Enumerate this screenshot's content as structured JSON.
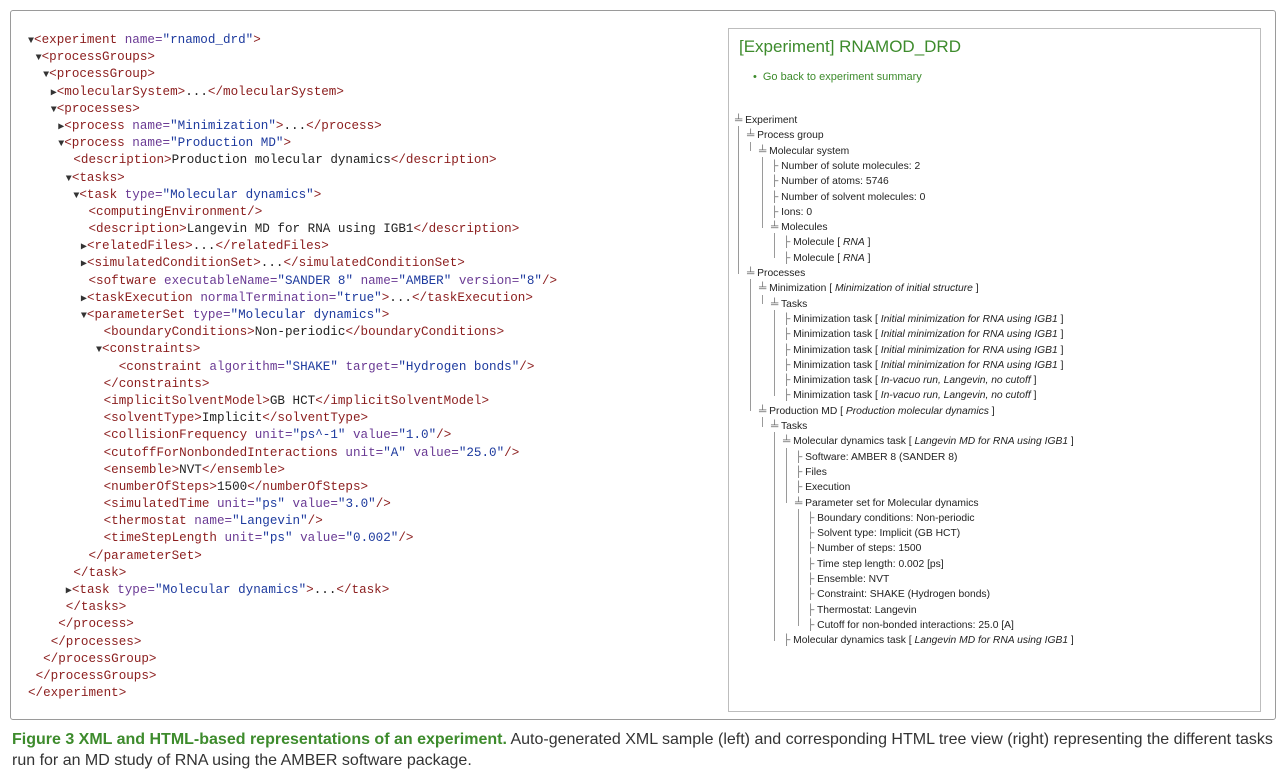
{
  "xml_lines": [
    {
      "d": 0,
      "h": [
        [
          "tri",
          "▼"
        ],
        [
          "tg",
          "<experiment "
        ],
        [
          "at",
          "name="
        ],
        [
          "av",
          "\"rnamod_drd\""
        ],
        [
          "tg",
          ">"
        ]
      ]
    },
    {
      "d": 1,
      "h": [
        [
          "tri",
          "▼"
        ],
        [
          "tg",
          "<processGroups>"
        ]
      ]
    },
    {
      "d": 2,
      "h": [
        [
          "tri",
          "▼"
        ],
        [
          "tg",
          "<processGroup>"
        ]
      ]
    },
    {
      "d": 3,
      "h": [
        [
          "tri",
          "▶"
        ],
        [
          "tg",
          "<molecularSystem>"
        ],
        [
          "tx",
          "..."
        ],
        [
          "tg",
          "</molecularSystem>"
        ]
      ]
    },
    {
      "d": 3,
      "h": [
        [
          "tri",
          "▼"
        ],
        [
          "tg",
          "<processes>"
        ]
      ]
    },
    {
      "d": 4,
      "h": [
        [
          "tri",
          "▶"
        ],
        [
          "tg",
          "<process "
        ],
        [
          "at",
          "name="
        ],
        [
          "av",
          "\"Minimization\""
        ],
        [
          "tg",
          ">"
        ],
        [
          "tx",
          "..."
        ],
        [
          "tg",
          "</process>"
        ]
      ]
    },
    {
      "d": 4,
      "h": [
        [
          "tri",
          "▼"
        ],
        [
          "tg",
          "<process "
        ],
        [
          "at",
          "name="
        ],
        [
          "av",
          "\"Production MD\""
        ],
        [
          "tg",
          ">"
        ]
      ]
    },
    {
      "d": 6,
      "h": [
        [
          "tg",
          "<description>"
        ],
        [
          "tx",
          "Production molecular dynamics"
        ],
        [
          "tg",
          "</description>"
        ]
      ]
    },
    {
      "d": 5,
      "h": [
        [
          "tri",
          "▼"
        ],
        [
          "tg",
          "<tasks>"
        ]
      ]
    },
    {
      "d": 6,
      "h": [
        [
          "tri",
          "▼"
        ],
        [
          "tg",
          "<task "
        ],
        [
          "at",
          "type="
        ],
        [
          "av",
          "\"Molecular dynamics\""
        ],
        [
          "tg",
          ">"
        ]
      ]
    },
    {
      "d": 8,
      "h": [
        [
          "tg",
          "<computingEnvironment/>"
        ]
      ]
    },
    {
      "d": 8,
      "h": [
        [
          "tg",
          "<description>"
        ],
        [
          "tx",
          "Langevin MD for RNA using IGB1"
        ],
        [
          "tg",
          "</description>"
        ]
      ]
    },
    {
      "d": 7,
      "h": [
        [
          "tri",
          "▶"
        ],
        [
          "tg",
          "<relatedFiles>"
        ],
        [
          "tx",
          "..."
        ],
        [
          "tg",
          "</relatedFiles>"
        ]
      ]
    },
    {
      "d": 7,
      "h": [
        [
          "tri",
          "▶"
        ],
        [
          "tg",
          "<simulatedConditionSet>"
        ],
        [
          "tx",
          "..."
        ],
        [
          "tg",
          "</simulatedConditionSet>"
        ]
      ]
    },
    {
      "d": 8,
      "h": [
        [
          "tg",
          "<software "
        ],
        [
          "at",
          "executableName="
        ],
        [
          "av",
          "\"SANDER 8\" "
        ],
        [
          "at",
          "name="
        ],
        [
          "av",
          "\"AMBER\" "
        ],
        [
          "at",
          "version="
        ],
        [
          "av",
          "\"8\""
        ],
        [
          "tg",
          "/>"
        ]
      ]
    },
    {
      "d": 7,
      "h": [
        [
          "tri",
          "▶"
        ],
        [
          "tg",
          "<taskExecution "
        ],
        [
          "at",
          "normalTermination="
        ],
        [
          "av",
          "\"true\""
        ],
        [
          "tg",
          ">"
        ],
        [
          "tx",
          "..."
        ],
        [
          "tg",
          "</taskExecution>"
        ]
      ]
    },
    {
      "d": 7,
      "h": [
        [
          "tri",
          "▼"
        ],
        [
          "tg",
          "<parameterSet "
        ],
        [
          "at",
          "type="
        ],
        [
          "av",
          "\"Molecular dynamics\""
        ],
        [
          "tg",
          ">"
        ]
      ]
    },
    {
      "d": 10,
      "h": [
        [
          "tg",
          "<boundaryConditions>"
        ],
        [
          "tx",
          "Non-periodic"
        ],
        [
          "tg",
          "</boundaryConditions>"
        ]
      ]
    },
    {
      "d": 9,
      "h": [
        [
          "tri",
          "▼"
        ],
        [
          "tg",
          "<constraints>"
        ]
      ]
    },
    {
      "d": 12,
      "h": [
        [
          "tg",
          "<constraint "
        ],
        [
          "at",
          "algorithm="
        ],
        [
          "av",
          "\"SHAKE\" "
        ],
        [
          "at",
          "target="
        ],
        [
          "av",
          "\"Hydrogen bonds\""
        ],
        [
          "tg",
          "/>"
        ]
      ]
    },
    {
      "d": 10,
      "h": [
        [
          "tg",
          "</constraints>"
        ]
      ]
    },
    {
      "d": 10,
      "h": [
        [
          "tg",
          "<implicitSolventModel>"
        ],
        [
          "tx",
          "GB HCT"
        ],
        [
          "tg",
          "</implicitSolventModel>"
        ]
      ]
    },
    {
      "d": 10,
      "h": [
        [
          "tg",
          "<solventType>"
        ],
        [
          "tx",
          "Implicit"
        ],
        [
          "tg",
          "</solventType>"
        ]
      ]
    },
    {
      "d": 10,
      "h": [
        [
          "tg",
          "<collisionFrequency "
        ],
        [
          "at",
          "unit="
        ],
        [
          "av",
          "\"ps^-1\" "
        ],
        [
          "at",
          "value="
        ],
        [
          "av",
          "\"1.0\""
        ],
        [
          "tg",
          "/>"
        ]
      ]
    },
    {
      "d": 10,
      "h": [
        [
          "tg",
          "<cutoffForNonbondedInteractions "
        ],
        [
          "at",
          "unit="
        ],
        [
          "av",
          "\"A\" "
        ],
        [
          "at",
          "value="
        ],
        [
          "av",
          "\"25.0\""
        ],
        [
          "tg",
          "/>"
        ]
      ]
    },
    {
      "d": 10,
      "h": [
        [
          "tg",
          "<ensemble>"
        ],
        [
          "tx",
          "NVT"
        ],
        [
          "tg",
          "</ensemble>"
        ]
      ]
    },
    {
      "d": 10,
      "h": [
        [
          "tg",
          "<numberOfSteps>"
        ],
        [
          "tx",
          "1500"
        ],
        [
          "tg",
          "</numberOfSteps>"
        ]
      ]
    },
    {
      "d": 10,
      "h": [
        [
          "tg",
          "<simulatedTime "
        ],
        [
          "at",
          "unit="
        ],
        [
          "av",
          "\"ps\" "
        ],
        [
          "at",
          "value="
        ],
        [
          "av",
          "\"3.0\""
        ],
        [
          "tg",
          "/>"
        ]
      ]
    },
    {
      "d": 10,
      "h": [
        [
          "tg",
          "<thermostat "
        ],
        [
          "at",
          "name="
        ],
        [
          "av",
          "\"Langevin\""
        ],
        [
          "tg",
          "/>"
        ]
      ]
    },
    {
      "d": 10,
      "h": [
        [
          "tg",
          "<timeStepLength "
        ],
        [
          "at",
          "unit="
        ],
        [
          "av",
          "\"ps\" "
        ],
        [
          "at",
          "value="
        ],
        [
          "av",
          "\"0.002\""
        ],
        [
          "tg",
          "/>"
        ]
      ]
    },
    {
      "d": 8,
      "h": [
        [
          "tg",
          "</parameterSet>"
        ]
      ]
    },
    {
      "d": 6,
      "h": [
        [
          "tg",
          "</task>"
        ]
      ]
    },
    {
      "d": 5,
      "h": [
        [
          "tri",
          "▶"
        ],
        [
          "tg",
          "<task "
        ],
        [
          "at",
          "type="
        ],
        [
          "av",
          "\"Molecular dynamics\""
        ],
        [
          "tg",
          ">"
        ],
        [
          "tx",
          "..."
        ],
        [
          "tg",
          "</task>"
        ]
      ]
    },
    {
      "d": 5,
      "h": [
        [
          "tg",
          "</tasks>"
        ]
      ]
    },
    {
      "d": 4,
      "h": [
        [
          "tg",
          "</process>"
        ]
      ]
    },
    {
      "d": 3,
      "h": [
        [
          "tg",
          "</processes>"
        ]
      ]
    },
    {
      "d": 2,
      "h": [
        [
          "tg",
          "</processGroup>"
        ]
      ]
    },
    {
      "d": 1,
      "h": [
        [
          "tg",
          "</processGroups>"
        ]
      ]
    },
    {
      "d": 0,
      "h": [
        [
          "tg",
          "</experiment>"
        ]
      ]
    }
  ],
  "tree": {
    "title": "[Experiment] RNAMOD_DRD",
    "back_link": "Go back to experiment summary",
    "nodes": [
      {
        "d": 0,
        "e": true,
        "t": "Experiment"
      },
      {
        "d": 1,
        "e": true,
        "t": "Process group"
      },
      {
        "d": 2,
        "e": true,
        "t": "Molecular system"
      },
      {
        "d": 3,
        "t": "Number of solute molecules: 2"
      },
      {
        "d": 3,
        "t": "Number of atoms: 5746"
      },
      {
        "d": 3,
        "t": "Number of solvent molecules: 0"
      },
      {
        "d": 3,
        "t": "Ions: 0"
      },
      {
        "d": 3,
        "e": true,
        "t": "Molecules"
      },
      {
        "d": 4,
        "t": "Molecule [ ",
        "i": "RNA",
        "s": " ]"
      },
      {
        "d": 4,
        "t": "Molecule [ ",
        "i": "RNA",
        "s": " ]"
      },
      {
        "d": 1,
        "e": true,
        "t": "Processes"
      },
      {
        "d": 2,
        "e": true,
        "t": "Minimization  [ ",
        "i": "Minimization of initial structure",
        "s": " ]"
      },
      {
        "d": 3,
        "e": true,
        "t": "Tasks"
      },
      {
        "d": 4,
        "t": "Minimization task [ ",
        "i": "Initial minimization for RNA using IGB1",
        "s": " ]"
      },
      {
        "d": 4,
        "t": "Minimization task [ ",
        "i": "Initial minimization for RNA using IGB1",
        "s": " ]"
      },
      {
        "d": 4,
        "t": "Minimization task [ ",
        "i": "Initial minimization for RNA using IGB1",
        "s": " ]"
      },
      {
        "d": 4,
        "t": "Minimization task [ ",
        "i": "Initial minimization for RNA using IGB1",
        "s": " ]"
      },
      {
        "d": 4,
        "t": "Minimization task [ ",
        "i": "In-vacuo run, Langevin, no cutoff",
        "s": " ]"
      },
      {
        "d": 4,
        "t": "Minimization task [ ",
        "i": "In-vacuo run, Langevin, no cutoff",
        "s": " ]"
      },
      {
        "d": 2,
        "e": true,
        "t": "Production MD  [ ",
        "i": "Production molecular dynamics",
        "s": " ]"
      },
      {
        "d": 3,
        "e": true,
        "t": "Tasks"
      },
      {
        "d": 4,
        "e": true,
        "t": "Molecular dynamics task [ ",
        "i": "Langevin MD for RNA using IGB1",
        "s": " ]"
      },
      {
        "d": 5,
        "t": "Software: AMBER  8  (SANDER 8)"
      },
      {
        "d": 5,
        "t": "Files"
      },
      {
        "d": 5,
        "t": "Execution"
      },
      {
        "d": 5,
        "e": true,
        "t": "Parameter set for Molecular dynamics"
      },
      {
        "d": 6,
        "t": "Boundary conditions: Non-periodic"
      },
      {
        "d": 6,
        "t": "Solvent type: Implicit (GB HCT)"
      },
      {
        "d": 6,
        "t": "Number of steps: 1500"
      },
      {
        "d": 6,
        "t": "Time step length: 0.002 [ps]"
      },
      {
        "d": 6,
        "t": "Ensemble: NVT"
      },
      {
        "d": 6,
        "t": "Constraint: SHAKE (Hydrogen bonds)"
      },
      {
        "d": 6,
        "t": "Thermostat: Langevin"
      },
      {
        "d": 6,
        "t": "Cutoff for non-bonded interactions: 25.0 [A]"
      },
      {
        "d": 4,
        "t": "Molecular dynamics task [ ",
        "i": "Langevin MD for RNA using IGB1",
        "s": " ]"
      }
    ]
  },
  "caption": {
    "bold": "Figure 3 XML and HTML-based representations of an experiment.",
    "text": " Auto-generated XML sample (left) and corresponding HTML tree view (right) representing the different tasks run for an MD study of RNA using the AMBER software package."
  },
  "colors": {
    "tag": "#8b1d1d",
    "attr": "#6a3a94",
    "value": "#1d3a9e",
    "accent": "#3d8b2c"
  }
}
